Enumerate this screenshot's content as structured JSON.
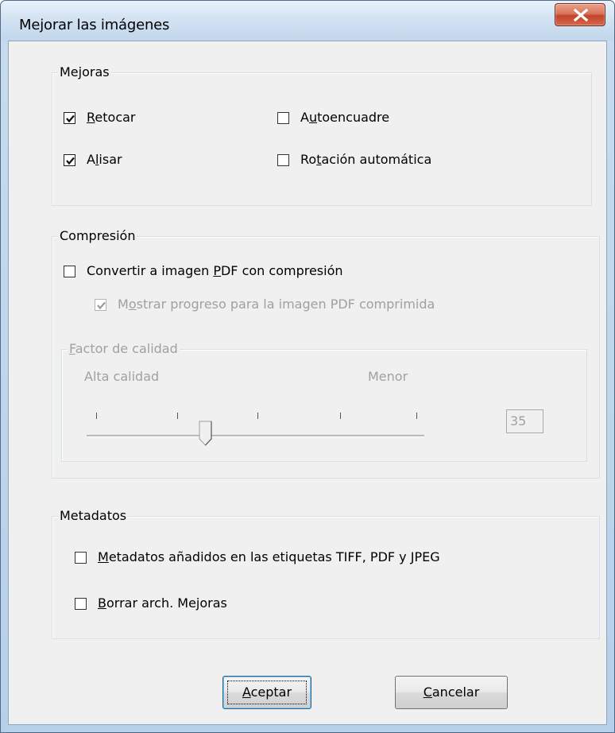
{
  "window": {
    "title": "Mejorar las imágenes",
    "close_icon": "close-x-icon"
  },
  "mejoras": {
    "legend": "Mejoras",
    "retocar": {
      "label_key": "R",
      "label_rest": "etocar",
      "checked": true
    },
    "alisar": {
      "label_pre": "A",
      "label_key": "l",
      "label_rest": "isar",
      "checked": true
    },
    "autoencuadre": {
      "label_pre": "A",
      "label_key": "u",
      "label_rest": "toencuadre",
      "checked": false
    },
    "rotacion": {
      "label_pre": "Ro",
      "label_key": "t",
      "label_rest": "ación automática",
      "checked": false
    }
  },
  "compresion": {
    "legend": "Compresión",
    "convertir": {
      "label_pre": "Convertir a imagen ",
      "label_key": "P",
      "label_rest": "DF con compresión",
      "checked": false
    },
    "mostrar": {
      "label_pre": "M",
      "label_key": "o",
      "label_rest": "strar progreso para la imagen PDF comprimida",
      "checked": true,
      "disabled": true
    },
    "factor": {
      "legend_key": "F",
      "legend_rest": "actor de calidad",
      "high_label": "Alta calidad",
      "low_label": "Menor",
      "value": "35",
      "slider_position": 0.375
    }
  },
  "metadatos": {
    "legend": "Metadatos",
    "anadidos": {
      "label_key": "M",
      "label_rest": "etadatos añadidos en las etiquetas TIFF, PDF y JPEG",
      "checked": false
    },
    "borrar": {
      "label_key": "B",
      "label_rest": "orrar arch. Mejoras",
      "checked": false
    }
  },
  "buttons": {
    "ok": {
      "label_key": "A",
      "label_rest": "ceptar"
    },
    "cancel": {
      "label_key": "C",
      "label_rest": "ancelar"
    }
  }
}
